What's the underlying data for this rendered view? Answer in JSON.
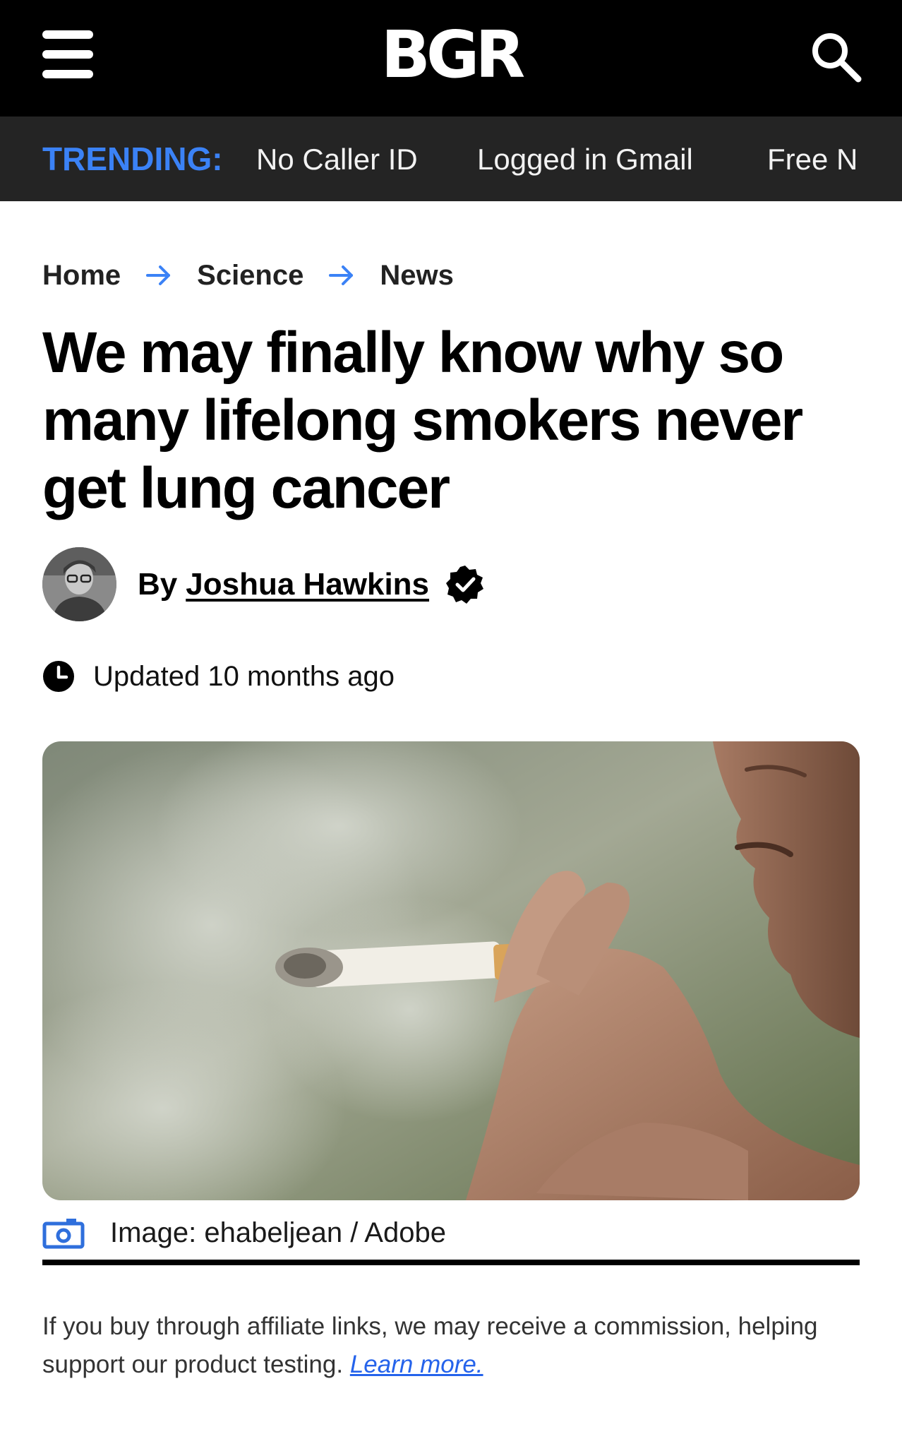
{
  "header": {
    "logo_text": "BGR",
    "menu_icon": "hamburger-menu-icon",
    "search_icon": "search-icon"
  },
  "trending": {
    "label": "TRENDING:",
    "items": [
      "No Caller ID",
      "Logged in Gmail",
      "Free N"
    ]
  },
  "breadcrumb": {
    "items": [
      "Home",
      "Science",
      "News"
    ],
    "separator_icon": "arrow-right-icon"
  },
  "article": {
    "title": "We may finally know why so many lifelong smokers never get lung cancer",
    "byline_prefix": "By",
    "author": "Joshua Hawkins",
    "verified_icon": "verified-badge-icon",
    "updated": "Updated 10 months ago",
    "clock_icon": "clock-icon",
    "image_credit": "Image: ehabeljean / Adobe",
    "camera_icon": "camera-icon"
  },
  "disclosure": {
    "text": "If you buy through affiliate links, we may receive a commission, helping support our product testing.",
    "link": "Learn more."
  },
  "colors": {
    "topbar": "#000000",
    "trending_bar": "#242424",
    "accent_blue": "#3b82f6",
    "link_blue": "#2563eb"
  }
}
